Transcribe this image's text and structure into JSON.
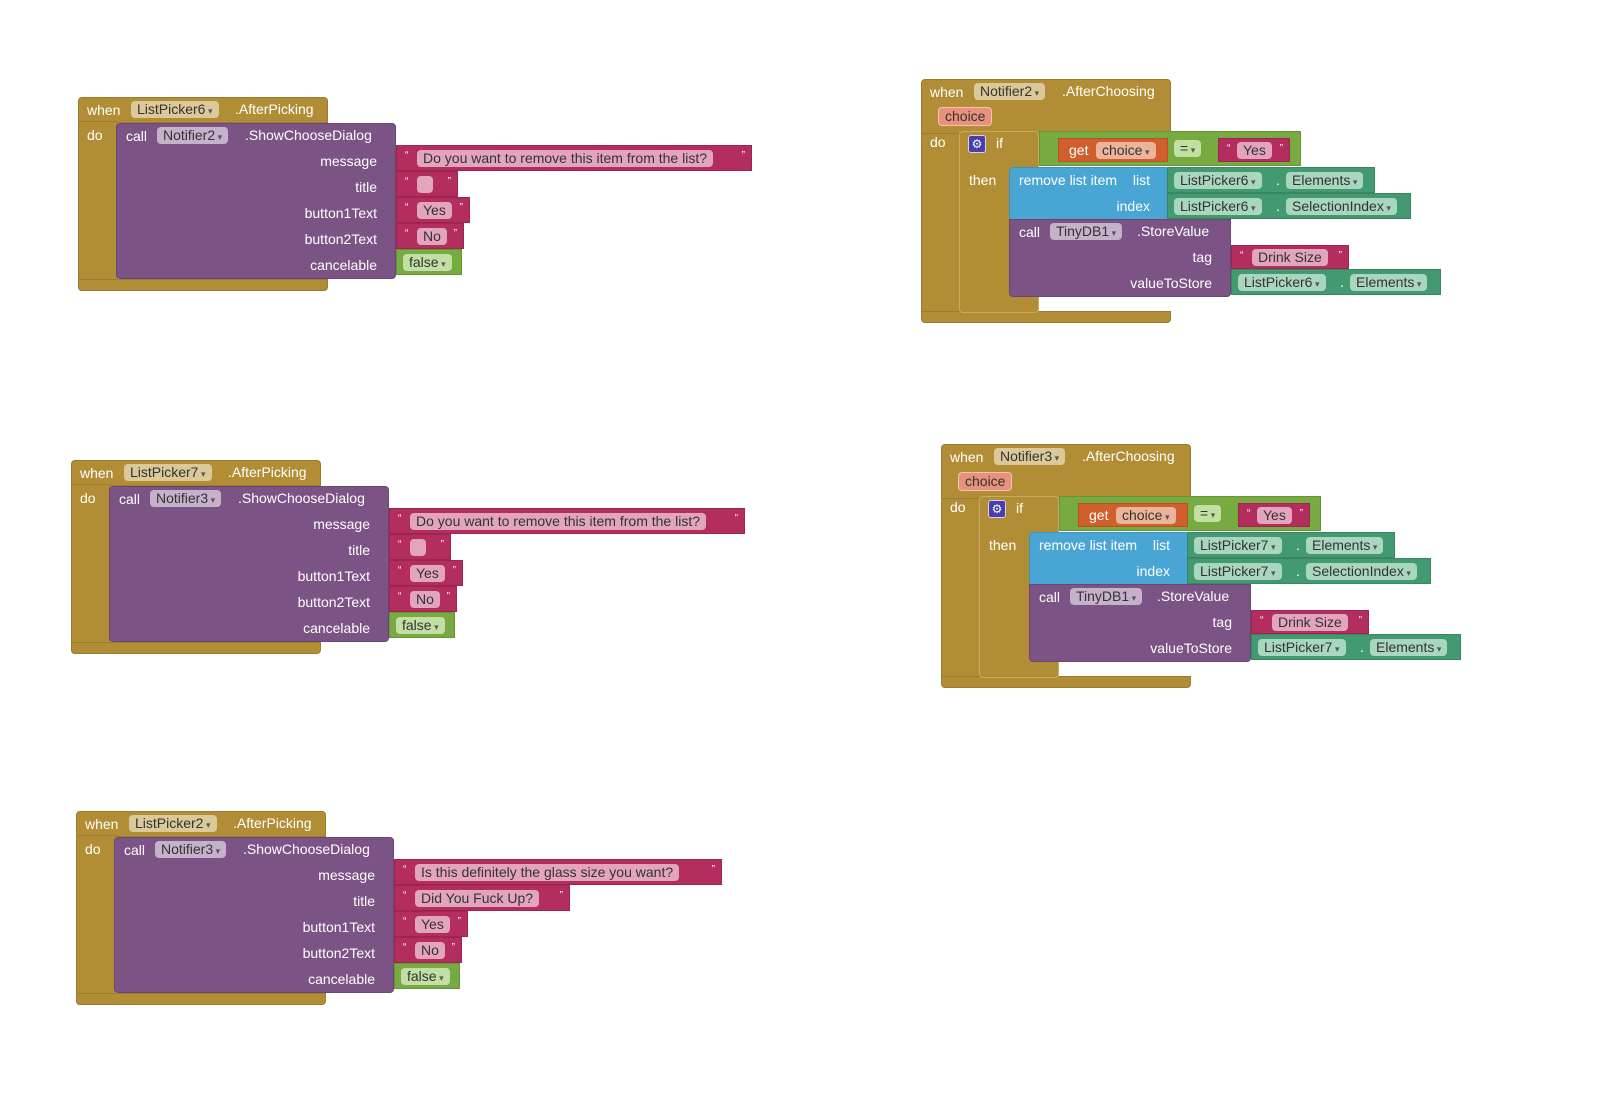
{
  "workspace": {
    "blocks": [
      {
        "id": "picker6_after_picking",
        "event": {
          "when": "when",
          "component": "ListPicker6",
          "event_name": ".AfterPicking",
          "do": "do"
        },
        "call": {
          "call": "call",
          "component": "Notifier2",
          "method": ".ShowChooseDialog"
        },
        "args": [
          {
            "label": "message",
            "value": "Do you want to remove this item from the list?",
            "type": "text"
          },
          {
            "label": "title",
            "value": "",
            "type": "text"
          },
          {
            "label": "button1Text",
            "value": "Yes",
            "type": "text"
          },
          {
            "label": "button2Text",
            "value": "No",
            "type": "text"
          },
          {
            "label": "cancelable",
            "value": "false",
            "type": "logic"
          }
        ]
      },
      {
        "id": "picker7_after_picking",
        "event": {
          "when": "when",
          "component": "ListPicker7",
          "event_name": ".AfterPicking",
          "do": "do"
        },
        "call": {
          "call": "call",
          "component": "Notifier3",
          "method": ".ShowChooseDialog"
        },
        "args": [
          {
            "label": "message",
            "value": "Do you want to remove this item from the list?",
            "type": "text"
          },
          {
            "label": "title",
            "value": "",
            "type": "text"
          },
          {
            "label": "button1Text",
            "value": "Yes",
            "type": "text"
          },
          {
            "label": "button2Text",
            "value": "No",
            "type": "text"
          },
          {
            "label": "cancelable",
            "value": "false",
            "type": "logic"
          }
        ]
      },
      {
        "id": "picker2_after_picking",
        "event": {
          "when": "when",
          "component": "ListPicker2",
          "event_name": ".AfterPicking",
          "do": "do"
        },
        "call": {
          "call": "call",
          "component": "Notifier3",
          "method": ".ShowChooseDialog"
        },
        "args": [
          {
            "label": "message",
            "value": "Is this definitely the glass size you want?",
            "type": "text"
          },
          {
            "label": "title",
            "value": "Did You Fuck Up?",
            "type": "text"
          },
          {
            "label": "button1Text",
            "value": "Yes",
            "type": "text"
          },
          {
            "label": "button2Text",
            "value": "No",
            "type": "text"
          },
          {
            "label": "cancelable",
            "value": "false",
            "type": "logic"
          }
        ]
      },
      {
        "id": "notifier2_after_choosing",
        "event": {
          "when": "when",
          "component": "Notifier2",
          "event_name": ".AfterChoosing",
          "param": "choice",
          "do": "do"
        },
        "if": {
          "if": "if",
          "then": "then",
          "get": "get",
          "var": "choice",
          "op": "=",
          "compare": "Yes"
        },
        "remove": {
          "label": "remove list item",
          "list_label": "list",
          "index_label": "index",
          "list_component": "ListPicker6",
          "list_prop": "Elements",
          "dot": ".",
          "index_component": "ListPicker6",
          "index_prop": "SelectionIndex"
        },
        "store": {
          "call": "call",
          "component": "TinyDB1",
          "method": ".StoreValue",
          "tag_label": "tag",
          "tag": "Drink Size",
          "value_label": "valueToStore",
          "value_component": "ListPicker6",
          "value_prop": "Elements"
        }
      },
      {
        "id": "notifier3_after_choosing",
        "event": {
          "when": "when",
          "component": "Notifier3",
          "event_name": ".AfterChoosing",
          "param": "choice",
          "do": "do"
        },
        "if": {
          "if": "if",
          "then": "then",
          "get": "get",
          "var": "choice",
          "op": "=",
          "compare": "Yes"
        },
        "remove": {
          "label": "remove list item",
          "list_label": "list",
          "index_label": "index",
          "list_component": "ListPicker7",
          "list_prop": "Elements",
          "dot": ".",
          "index_component": "ListPicker7",
          "index_prop": "SelectionIndex"
        },
        "store": {
          "call": "call",
          "component": "TinyDB1",
          "method": ".StoreValue",
          "tag_label": "tag",
          "tag": "Drink Size",
          "value_label": "valueToStore",
          "value_component": "ListPicker7",
          "value_prop": "Elements"
        }
      }
    ],
    "quote_open": "“",
    "quote_close": "”"
  }
}
